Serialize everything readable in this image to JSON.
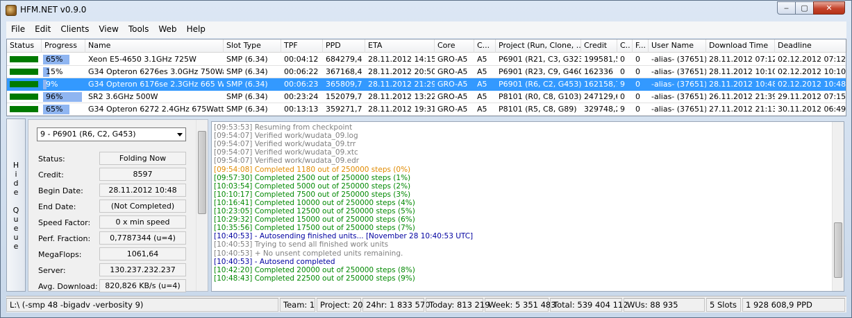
{
  "window": {
    "title": "HFM.NET v0.9.0",
    "min_label": "‒",
    "max_label": "▢",
    "close_label": "✕"
  },
  "menu": [
    "File",
    "Edit",
    "Clients",
    "View",
    "Tools",
    "Web",
    "Help"
  ],
  "columns": [
    "Status",
    "Progress",
    "Name",
    "Slot Type",
    "TPF",
    "PPD",
    "ETA",
    "Core",
    "C...",
    "Project (Run, Clone, ...",
    "Credit",
    "C..",
    "F...",
    "User Name",
    "Download Time",
    "Deadline"
  ],
  "rows": [
    {
      "progress": "65%",
      "progress_value": 65,
      "name": "Xeon E5-4650 3.1GHz 725W",
      "slot": "SMP (6.34)",
      "tpf": "00:04:12",
      "ppd": "684279,4",
      "eta": "28.11.2012 14:15",
      "core": "GRO-A5",
      "c": "A5",
      "project": "P6901 (R21, C3, G323)",
      "credit": "199581,5",
      "c2": "0",
      "f": "0",
      "user": "-alias- (37651)",
      "download": "28.11.2012 07:12",
      "deadline": "02.12.2012 07:12"
    },
    {
      "progress": "15%",
      "progress_value": 15,
      "name": "G34 Opteron 6276es 3.0GHz 750Watt",
      "slot": "SMP (6.34)",
      "tpf": "00:06:22",
      "ppd": "367168,4",
      "eta": "28.11.2012 20:50",
      "core": "GRO-A5",
      "c": "A5",
      "project": "P6901 (R23, C9, G460)",
      "credit": "162336",
      "c2": "0",
      "f": "0",
      "user": "-alias- (37651)",
      "download": "28.11.2012 10:10",
      "deadline": "02.12.2012 10:10"
    },
    {
      "progress": "9%",
      "progress_value": 9,
      "name": "G34 Opteron 6176se 2.3GHz 665 Watt",
      "slot": "SMP (6.34)",
      "tpf": "00:06:23",
      "ppd": "365809,7",
      "eta": "28.11.2012 21:29",
      "core": "GRO-A5",
      "c": "A5",
      "project": "P6901 (R6, C2, G453)",
      "credit": "162158,7",
      "c2": "9",
      "f": "0",
      "user": "-alias- (37651)",
      "download": "28.11.2012 10:48",
      "deadline": "02.12.2012 10:48"
    },
    {
      "progress": "96%",
      "progress_value": 96,
      "name": "SR2 3.6GHz 500W",
      "slot": "SMP (6.34)",
      "tpf": "00:23:24",
      "ppd": "152079,7",
      "eta": "28.11.2012 13:22",
      "core": "GRO-A5",
      "c": "A5",
      "project": "P8101 (R0, C8, G103)",
      "credit": "247129,6",
      "c2": "0",
      "f": "0",
      "user": "-alias- (37651)",
      "download": "26.11.2012 21:39",
      "deadline": "29.11.2012 07:15"
    },
    {
      "progress": "65%",
      "progress_value": 65,
      "name": "G34 Opteron 6272 2.4GHz 675Watt",
      "slot": "SMP (6.34)",
      "tpf": "00:13:13",
      "ppd": "359271,7",
      "eta": "28.11.2012 19:31",
      "core": "GRO-A5",
      "c": "A5",
      "project": "P8101 (R5, C8, G89)",
      "credit": "329748,2",
      "c2": "9",
      "f": "0",
      "user": "-alias- (37651)",
      "download": "27.11.2012 21:13",
      "deadline": "30.11.2012 06:49"
    }
  ],
  "hide_queue": [
    "H",
    "i",
    "d",
    "e",
    "",
    "Q",
    "u",
    "e",
    "u",
    "e"
  ],
  "queue": {
    "selected": "9 - P6901 (R6, C2, G453)",
    "fields": [
      {
        "label": "Status:",
        "value": "Folding Now"
      },
      {
        "label": "Credit:",
        "value": "8597"
      },
      {
        "label": "Begin Date:",
        "value": "28.11.2012 10:48"
      },
      {
        "label": "End Date:",
        "value": "(Not Completed)"
      },
      {
        "label": "Speed Factor:",
        "value": "0 x min speed"
      },
      {
        "label": "Perf. Fraction:",
        "value": "0,7787344 (u=4)"
      },
      {
        "label": "MegaFlops:",
        "value": "1061,64"
      },
      {
        "label": "Server:",
        "value": "130.237.232.237"
      },
      {
        "label": "Avg. Download:",
        "value": "820,826 KB/s (u=4)"
      }
    ]
  },
  "log": [
    {
      "text": "[09:53:53] Resuming from checkpoint",
      "color": "gray"
    },
    {
      "text": "[09:54:07] Verified work/wudata_09.log",
      "color": "gray"
    },
    {
      "text": "[09:54:07] Verified work/wudata_09.trr",
      "color": "gray"
    },
    {
      "text": "[09:54:07] Verified work/wudata_09.xtc",
      "color": "gray"
    },
    {
      "text": "[09:54:07] Verified work/wudata_09.edr",
      "color": "gray"
    },
    {
      "text": "[09:54:08] Completed 1180 out of 250000 steps  (0%)",
      "color": "orange"
    },
    {
      "text": "[09:57:30] Completed 2500 out of 250000 steps  (1%)",
      "color": "green"
    },
    {
      "text": "[10:03:54] Completed 5000 out of 250000 steps  (2%)",
      "color": "green"
    },
    {
      "text": "[10:10:17] Completed 7500 out of 250000 steps  (3%)",
      "color": "green"
    },
    {
      "text": "[10:16:41] Completed 10000 out of 250000 steps  (4%)",
      "color": "green"
    },
    {
      "text": "[10:23:05] Completed 12500 out of 250000 steps  (5%)",
      "color": "green"
    },
    {
      "text": "[10:29:32] Completed 15000 out of 250000 steps  (6%)",
      "color": "green"
    },
    {
      "text": "[10:35:56] Completed 17500 out of 250000 steps  (7%)",
      "color": "green"
    },
    {
      "text": "[10:40:53] - Autosending finished units... [November 28 10:40:53 UTC]",
      "color": "blue"
    },
    {
      "text": "[10:40:53] Trying to send all finished work units",
      "color": "gray"
    },
    {
      "text": "[10:40:53] + No unsent completed units remaining.",
      "color": "gray"
    },
    {
      "text": "[10:40:53] - Autosend completed",
      "color": "blue"
    },
    {
      "text": "[10:42:20] Completed 20000 out of 250000 steps  (8%)",
      "color": "green"
    },
    {
      "text": "[10:48:43] Completed 22500 out of 250000 steps  (9%)",
      "color": "green"
    }
  ],
  "statusbar": {
    "cmd": "L:\\ (-smp 48 -bigadv -verbosity 9)",
    "team": "Team: 1",
    "project": "Project: 20",
    "h24": "24hr: 1 833 570",
    "today": "Today: 813 219",
    "week": "Week: 5 351 483",
    "total": "Total: 539 404 112",
    "wus": "WUs: 88 935",
    "slots": "5 Slots",
    "ppd": "1 928 608,9 PPD"
  },
  "colors": {
    "selection": "#3399ff",
    "status_ok": "#007a00",
    "progress_fill": "#8fb5f1"
  }
}
